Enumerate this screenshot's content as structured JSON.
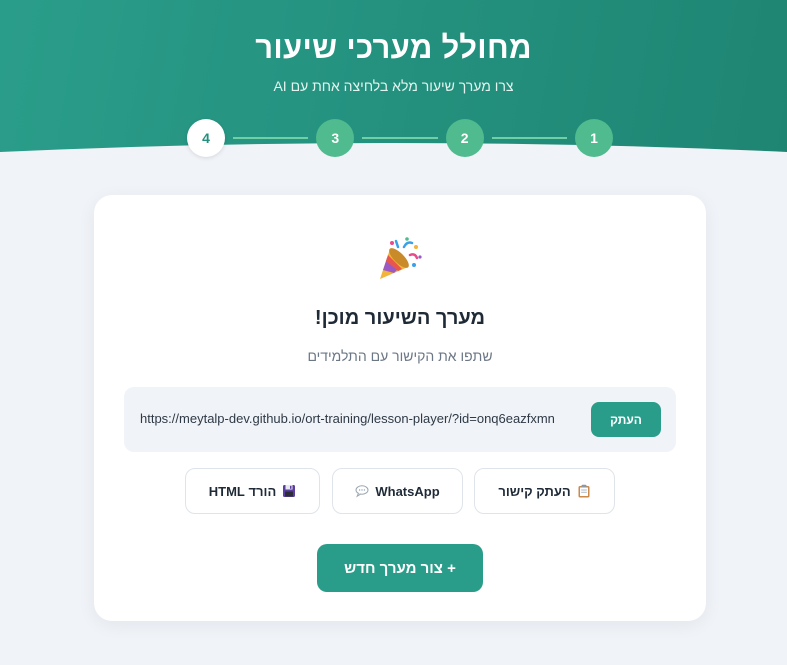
{
  "header": {
    "title": "מחולל מערכי שיעור",
    "subtitle": "צרו מערך שיעור מלא בלחיצה אחת עם AI"
  },
  "stepper": {
    "steps": [
      "1",
      "2",
      "3",
      "4"
    ],
    "active_step": "4"
  },
  "result_card": {
    "emoji_icon": "party-popper-icon",
    "title": "מערך השיעור מוכן!",
    "subtitle": "שתפו את הקישור עם התלמידים",
    "link_url": "https://meytalp-dev.github.io/ort-training/lesson-player/?id=onq6eazfxmn",
    "copy_button": "העתק",
    "actions": {
      "copy_link": "העתק קישור",
      "whatsapp": "WhatsApp",
      "download_html": "הורד HTML"
    },
    "new_button": "+ צור מערך חדש"
  },
  "colors": {
    "primary": "#2a9d8a",
    "step_done": "#4fbb8e",
    "background": "#f0f3f7"
  }
}
